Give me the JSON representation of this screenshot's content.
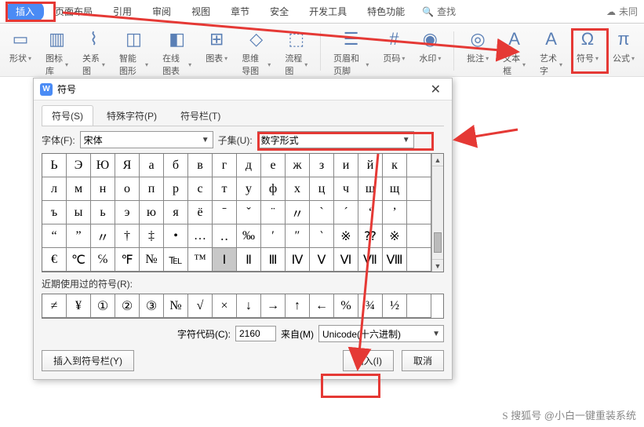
{
  "menubar": {
    "tabs": [
      "插入",
      "页面布局",
      "引用",
      "审阅",
      "视图",
      "章节",
      "安全",
      "开发工具",
      "特色功能"
    ],
    "search": "查找",
    "right": "未同"
  },
  "ribbon": {
    "items": [
      {
        "icon": "▭",
        "label": "形状"
      },
      {
        "icon": "▥",
        "label": "图标库"
      },
      {
        "icon": "⌇",
        "label": "关系图"
      },
      {
        "icon": "◫",
        "label": "智能图形"
      },
      {
        "icon": "◧",
        "label": "在线图表"
      },
      {
        "icon": "⊞",
        "label": "图表"
      },
      {
        "icon": "◇",
        "label": "思维导图"
      },
      {
        "icon": "⬚",
        "label": "流程图"
      },
      {
        "icon": "☰",
        "label": "页眉和页脚"
      },
      {
        "icon": "#",
        "label": "页码"
      },
      {
        "icon": "◉",
        "label": "水印"
      },
      {
        "icon": "◎",
        "label": "批注"
      },
      {
        "icon": "A",
        "label": "文本框"
      },
      {
        "icon": "A",
        "label": "艺术字"
      },
      {
        "icon": "Ω",
        "label": "符号"
      },
      {
        "icon": "π",
        "label": "公式"
      }
    ]
  },
  "dialog": {
    "title": "符号",
    "tabs": [
      "符号(S)",
      "特殊字符(P)",
      "符号栏(T)"
    ],
    "font_label": "字体(F):",
    "font_value": "宋体",
    "subset_label": "子集(U):",
    "subset_value": "数字形式",
    "grid_rows": [
      [
        "Ь",
        "Э",
        "Ю",
        "Я",
        "а",
        "б",
        "в",
        "г",
        "д",
        "е",
        "ж",
        "з",
        "и",
        "й",
        "к",
        " "
      ],
      [
        "л",
        "м",
        "н",
        "о",
        "п",
        "р",
        "с",
        "т",
        "у",
        "ф",
        "х",
        "ц",
        "ч",
        "ш",
        "щ",
        " "
      ],
      [
        "ъ",
        "ы",
        "ь",
        "э",
        "ю",
        "я",
        "ё",
        "ˉ",
        "ˇ",
        "¨",
        "〃",
        "ˋ",
        "ˊ",
        "‘",
        "’",
        " "
      ],
      [
        "“",
        "”",
        "〃",
        "†",
        "‡",
        "•",
        "…",
        "‥",
        "‰",
        "′",
        "″",
        "‵",
        "※",
        "⁇",
        "※",
        " "
      ],
      [
        "€",
        "℃",
        "℅",
        "℉",
        "№",
        "℡",
        "™",
        "Ⅰ",
        "Ⅱ",
        "Ⅲ",
        "Ⅳ",
        "Ⅴ",
        "Ⅵ",
        "Ⅶ",
        "Ⅷ",
        " "
      ]
    ],
    "selected_cell": "Ⅰ",
    "recent_label": "近期使用过的符号(R):",
    "recent": [
      "≠",
      "¥",
      "①",
      "②",
      "③",
      "№",
      "√",
      "×",
      "↓",
      "→",
      "↑",
      "←",
      "%",
      "¾",
      "½",
      " "
    ],
    "code_label": "字符代码(C):",
    "code_value": "2160",
    "from_label": "来自(M)",
    "from_value": "Unicode(十六进制)",
    "btn_addbar": "插入到符号栏(Y)",
    "btn_insert": "插入(I)",
    "btn_cancel": "取消"
  },
  "watermark": "搜狐号 @小白一键重装系统"
}
